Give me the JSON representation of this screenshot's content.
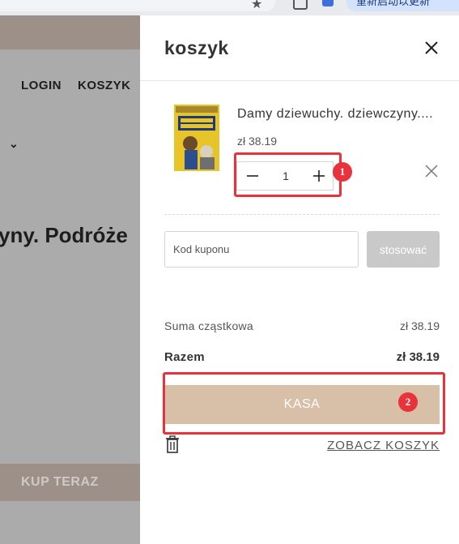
{
  "browser": {
    "extension_pill_text": "重新启动以更新"
  },
  "background_page": {
    "nav": {
      "login_label": "LOGIN",
      "cart_label": "KOSZYK"
    },
    "headline": "yny. Podróże",
    "buy_button_label": "KUP TERAZ"
  },
  "cart": {
    "title": "koszyk",
    "item": {
      "title": "Damy dziewuchy. dziewczyny....",
      "price": "zł 38.19",
      "quantity": "1",
      "cover_title": "DAMY DZIEWUCHY DZIEWCZYNY"
    },
    "coupon": {
      "placeholder": "Kod kuponu",
      "apply_label": "stosować"
    },
    "subtotal": {
      "label": "Suma cząstkowa",
      "value": "zł 38.19"
    },
    "total": {
      "label": "Razem",
      "value": "zł 38.19"
    },
    "checkout_label": "KASA",
    "view_cart_label": "ZOBACZ KOSZYK"
  },
  "annotations": {
    "badge1": "1",
    "badge2": "2",
    "color": "#e8323c"
  },
  "colors": {
    "accent": "#d8bfa7",
    "overlay": "#ababab",
    "apply_disabled": "#c9c9c9"
  }
}
